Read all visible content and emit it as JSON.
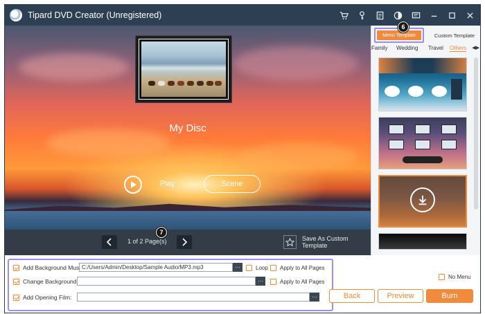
{
  "window": {
    "title": "Tipard DVD Creator (Unregistered)",
    "icons": [
      "cart-icon",
      "key-icon",
      "document-icon",
      "theme-icon",
      "feedback-icon",
      "minimize-icon",
      "maximize-icon",
      "close-icon"
    ]
  },
  "preview": {
    "disc_title": "My Disc",
    "play_label": "Play",
    "scene_label": "Scene"
  },
  "navbar": {
    "page_indicator": "1 of 2 Page(s)",
    "save_template_label": "Save As Custom Template"
  },
  "templates": {
    "tabs": [
      "Menu Template",
      "Custom Template"
    ],
    "active_tab": "Menu Template",
    "categories": [
      "Family",
      "Wedding",
      "Travel",
      "Others"
    ],
    "active_category": "Others",
    "callout_top": "6"
  },
  "options": {
    "callout": "7",
    "background_music": {
      "label": "Add Background Music:",
      "value": "C:/Users/Admin/Desktop/Sample Audio/MP3.mp3",
      "checked": true,
      "loop_label": "Loop",
      "apply_all_label": "Apply to All Pages"
    },
    "change_background": {
      "label": "Change Background:",
      "value": "",
      "checked": true,
      "apply_all_label": "Apply to All Pages"
    },
    "opening_film": {
      "label": "Add Opening Film:",
      "value": "",
      "checked": true
    },
    "no_menu_label": "No Menu"
  },
  "buttons": {
    "back": "Back",
    "preview": "Preview",
    "burn": "Burn"
  },
  "colors": {
    "accent": "#f08a3c",
    "titlebar": "#2d3f52",
    "highlight": "#9a8ef0"
  }
}
